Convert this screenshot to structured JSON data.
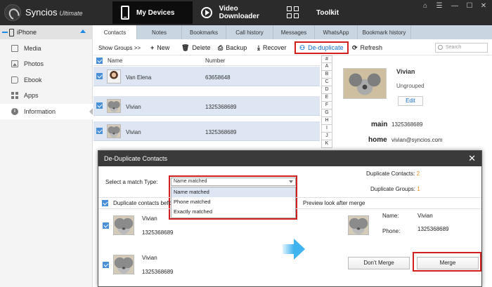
{
  "app": {
    "brand": "Syncios",
    "edition": "Ultimate",
    "nav": [
      {
        "label": "My Devices",
        "icon": "phone-icon",
        "active": true
      },
      {
        "label": "Video Downloader",
        "icon": "play-icon",
        "active": false
      },
      {
        "label": "Toolkit",
        "icon": "toolkit-icon",
        "active": false
      }
    ],
    "window_controls": [
      "⌂",
      "☰",
      "—",
      "☐",
      "✕"
    ]
  },
  "sidebar": {
    "device": "iPhone",
    "items": [
      {
        "label": "Media",
        "icon": "media-icon"
      },
      {
        "label": "Photos",
        "icon": "photos-icon"
      },
      {
        "label": "Ebook",
        "icon": "ebook-icon"
      },
      {
        "label": "Apps",
        "icon": "apps-icon"
      },
      {
        "label": "Information",
        "icon": "information-icon",
        "active": true
      }
    ]
  },
  "subtabs": [
    "Contacts",
    "Notes",
    "Bookmarks",
    "Call history",
    "Messages",
    "WhatsApp",
    "Bookmark history"
  ],
  "toolbar": {
    "show_groups": "Show Groups >>",
    "new": "New",
    "delete": "Delete",
    "backup": "Backup",
    "recover": "Recover",
    "deduplicate": "De-duplicate",
    "refresh": "Refresh",
    "search_placeholder": "Search"
  },
  "list": {
    "col_name": "Name",
    "col_number": "Number",
    "rows": [
      {
        "name": "Van Elena",
        "number": "63658648",
        "avatar": "person"
      },
      {
        "name": "Vivian",
        "number": "1325368689",
        "avatar": "koala"
      },
      {
        "name": "Vivian",
        "number": "1325368689",
        "avatar": "koala"
      }
    ],
    "alpha": [
      "#",
      "A",
      "B",
      "C",
      "D",
      "E",
      "F",
      "G",
      "H",
      "I",
      "J",
      "K"
    ]
  },
  "detail": {
    "name": "Vivian",
    "group": "Ungrouped",
    "edit": "Edit",
    "main_label": "main",
    "main_value": "1325368689",
    "home_label": "home",
    "home_value": "vivian@syncios.com"
  },
  "dialog": {
    "title": "De-Duplicate Contacts",
    "match_label": "Select a match Type:",
    "selected": "Name matched",
    "options": [
      "Name matched",
      "Phone matched",
      "Exactly matched"
    ],
    "dup_contacts_label": "Duplicate Contacts:",
    "dup_contacts_value": "2",
    "dup_groups_label": "Duplicate Groups:",
    "dup_groups_value": "1",
    "dup_before_label": "Duplicate contacts befo",
    "preview_label": "Preview look after merge",
    "entries": [
      {
        "name": "Vivian",
        "number": "1325368689"
      },
      {
        "name": "Vivian",
        "number": "1325368689"
      }
    ],
    "preview": {
      "name_label": "Name:",
      "name_value": "Vivian",
      "phone_label": "Phone:",
      "phone_value": "1325368689"
    },
    "dont_merge": "Don't Merge",
    "merge": "Merge"
  }
}
